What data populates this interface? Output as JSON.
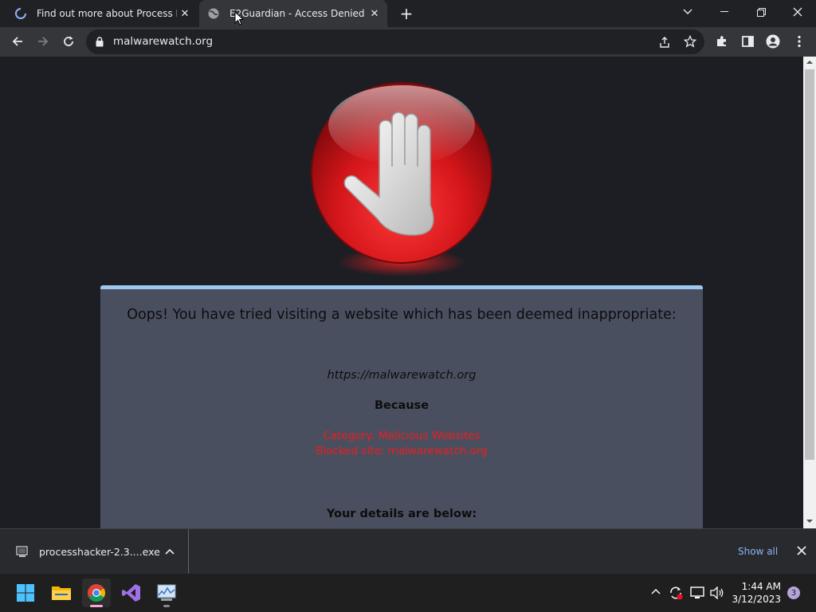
{
  "tabs": [
    {
      "title": "Find out more about Process Hac",
      "loading": true
    },
    {
      "title": "E2Guardian - Access Denied",
      "active": true
    }
  ],
  "toolbar": {
    "url": "malwarewatch.org"
  },
  "page": {
    "headline": "Oops! You have tried visiting a website which has been deemed inappropriate:",
    "blocked_url": "https://malwarewatch.org",
    "because": "Because",
    "reason_category": "Category: Malicious Websites",
    "reason_site": "Blocked site: malwarewatch.org",
    "details_heading": "Your details are below:"
  },
  "download": {
    "filename": "processhacker-2.3....exe",
    "show_all": "Show all"
  },
  "taskbar": {
    "time": "1:44 AM",
    "date": "3/12/2023",
    "notifications": "3"
  },
  "colors": {
    "accent": "#8ab4f8",
    "panel": "#4a4f60",
    "reason": "#ee1c1c",
    "stop_red": "#d4161a"
  }
}
